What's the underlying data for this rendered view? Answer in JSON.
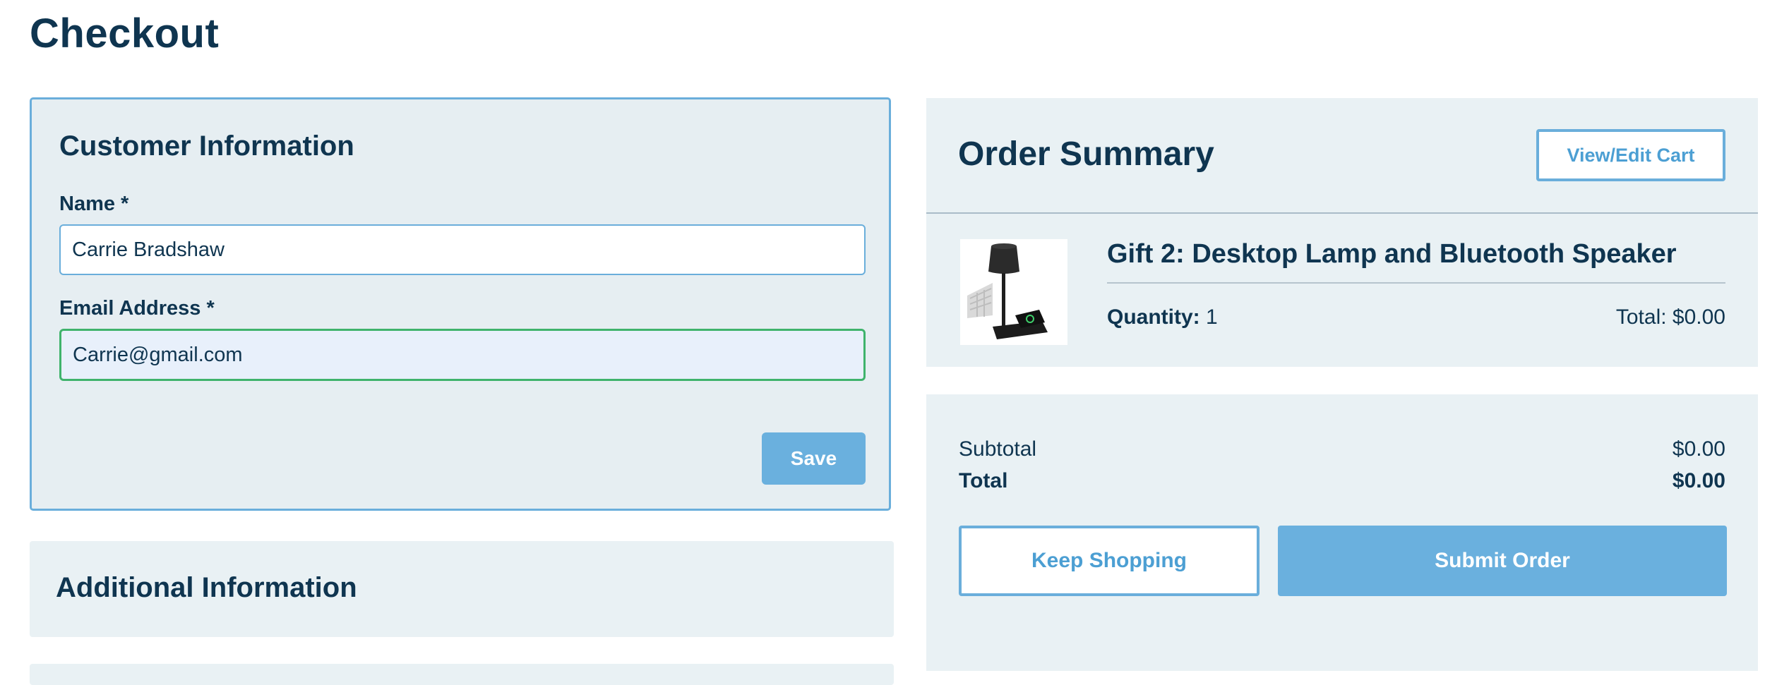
{
  "page": {
    "title": "Checkout"
  },
  "customer_info": {
    "heading": "Customer Information",
    "name_label": "Name *",
    "name_value": "Carrie Bradshaw",
    "email_label": "Email Address *",
    "email_value": "Carrie@gmail.com",
    "save_label": "Save"
  },
  "additional_info": {
    "heading": "Additional Information"
  },
  "order_summary": {
    "heading": "Order Summary",
    "view_edit_label": "View/Edit Cart",
    "item": {
      "name": "Gift 2: Desktop Lamp and Bluetooth Speaker",
      "quantity_label": "Quantity:",
      "quantity_value": "1",
      "total_text": "Total: $0.00",
      "image_icon": "lamp-product-image"
    }
  },
  "totals": {
    "subtotal_label": "Subtotal",
    "subtotal_value": "$0.00",
    "total_label": "Total",
    "total_value": "$0.00",
    "keep_shopping_label": "Keep Shopping",
    "submit_order_label": "Submit Order"
  },
  "colors": {
    "primary_text": "#0f3550",
    "accent_blue": "#6ab0de",
    "panel_bg": "#e9f1f4",
    "valid_green": "#3fb36c"
  }
}
